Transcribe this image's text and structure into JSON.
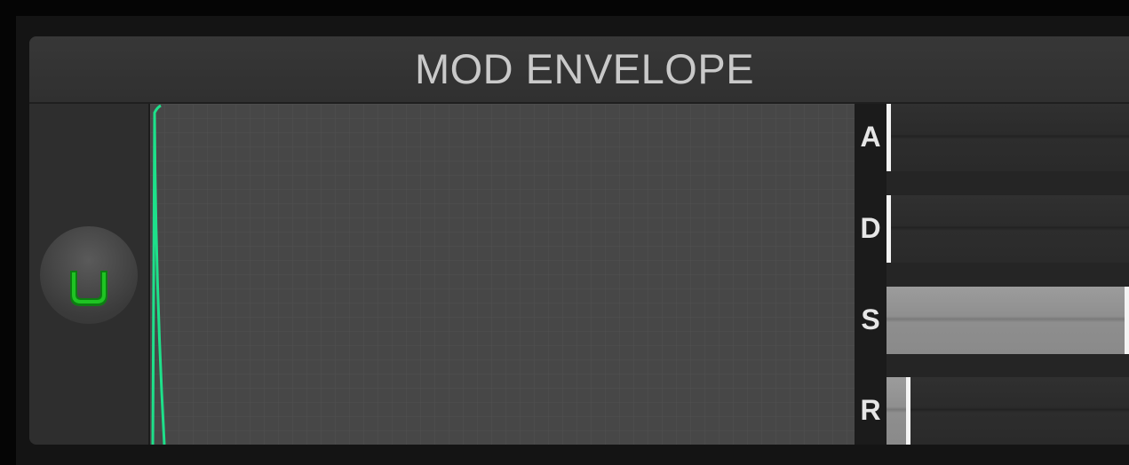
{
  "panel": {
    "title": "MOD ENVELOPE"
  },
  "power_button": {
    "icon": "power-u-icon",
    "state": "on",
    "color": "#10b015"
  },
  "graph": {
    "curve_color": "#1ee08a"
  },
  "sliders": [
    {
      "label": "A",
      "value": 0.0
    },
    {
      "label": "D",
      "value": 0.0
    },
    {
      "label": "S",
      "value": 1.0
    },
    {
      "label": "R",
      "value": 0.08
    }
  ]
}
